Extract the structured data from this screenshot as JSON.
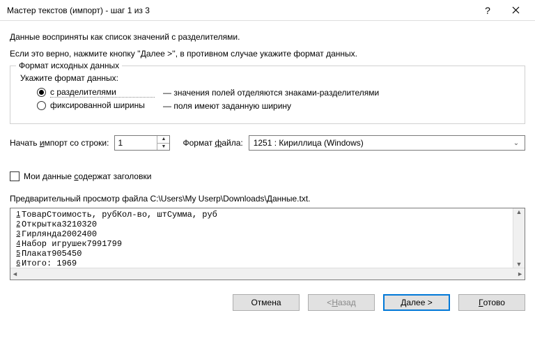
{
  "titlebar": {
    "title": "Мастер текстов (импорт) - шаг 1 из 3"
  },
  "intro": {
    "line1": "Данные восприняты как список значений с разделителями.",
    "line2": "Если это верно, нажмите кнопку ''Далее >'', в противном случае укажите формат данных."
  },
  "format_group": {
    "legend": "Формат исходных данных",
    "subhead": "Укажите формат данных:",
    "opt_delim_label": "с разделителями",
    "opt_delim_desc": "— значения полей отделяются знаками-разделителями",
    "opt_fixed_label": "фиксированной ширины",
    "opt_fixed_desc": "— поля имеют заданную ширину",
    "selected": "delimited"
  },
  "start_row": {
    "label_prefix": "Начать ",
    "label_accel": "и",
    "label_suffix": "мпорт со строки:",
    "value": "1"
  },
  "file_format": {
    "label_prefix": "Формат ",
    "label_accel": "ф",
    "label_suffix": "айла:",
    "value": "1251 : Кириллица (Windows)"
  },
  "headers_checkbox": {
    "label_prefix": "Мои данные ",
    "label_accel": "с",
    "label_suffix": "одержат заголовки",
    "checked": false
  },
  "preview": {
    "label": "Предварительный просмотр файла C:\\Users\\My Userр\\Downloads\\Данные.txt.",
    "lines": [
      "ТоварСтоимость, рубКол-во, штСумма, руб",
      "Открытка3210320",
      "Гирлянда2002400",
      "Набор игрушек7991799",
      "Плакат905450",
      "Итого: 1969"
    ]
  },
  "buttons": {
    "cancel": "Отмена",
    "back_prefix": "< ",
    "back_accel": "Н",
    "back_suffix": "азад",
    "next_accel": "Д",
    "next_suffix": "алее >",
    "finish_accel": "Г",
    "finish_suffix": "отово"
  }
}
